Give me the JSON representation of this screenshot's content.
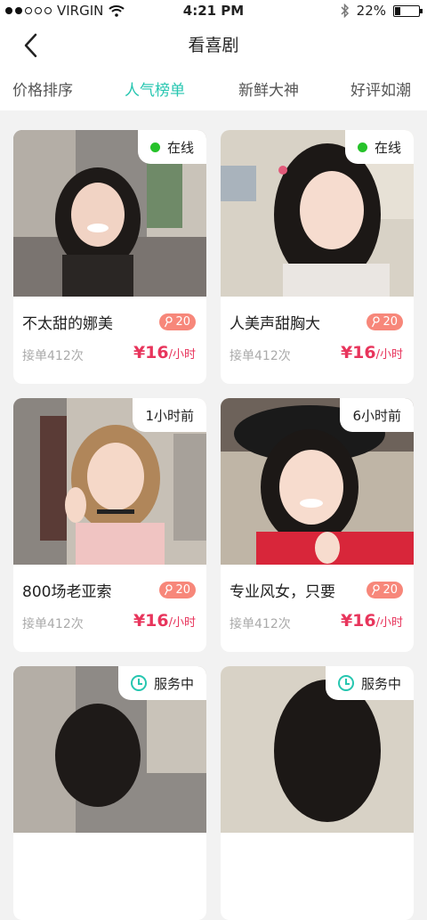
{
  "status_bar": {
    "carrier": "VIRGIN",
    "time": "4:21 PM",
    "battery_percent": "22%",
    "battery_level": 0.22
  },
  "nav": {
    "title": "看喜剧"
  },
  "tabs": [
    {
      "label": "价格排序",
      "active": false
    },
    {
      "label": "人气榜单",
      "active": true
    },
    {
      "label": "新鲜大神",
      "active": false
    },
    {
      "label": "好评如潮",
      "active": false
    }
  ],
  "cards": [
    {
      "status": "在线",
      "status_type": "online",
      "name": "不太甜的娜美",
      "gifts": "20",
      "orders": "接单412次",
      "price": "¥16",
      "unit": "/小时"
    },
    {
      "status": "在线",
      "status_type": "online",
      "name": "人美声甜胸大",
      "gifts": "20",
      "orders": "接单412次",
      "price": "¥16",
      "unit": "/小时"
    },
    {
      "status": "1小时前",
      "status_type": "time",
      "name": "800场老亚索",
      "gifts": "20",
      "orders": "接单412次",
      "price": "¥16",
      "unit": "/小时"
    },
    {
      "status": "6小时前",
      "status_type": "time",
      "name": "专业风女，只要",
      "gifts": "20",
      "orders": "接单412次",
      "price": "¥16",
      "unit": "/小时"
    },
    {
      "status": "服务中",
      "status_type": "serving",
      "name": "",
      "gifts": "",
      "orders": "",
      "price": "",
      "unit": ""
    },
    {
      "status": "服务中",
      "status_type": "serving",
      "name": "",
      "gifts": "",
      "orders": "",
      "price": "",
      "unit": ""
    }
  ],
  "colors": {
    "accent": "#26c6b0",
    "price": "#e8355c",
    "gift_badge": "#f7877a",
    "online": "#26c22a"
  }
}
